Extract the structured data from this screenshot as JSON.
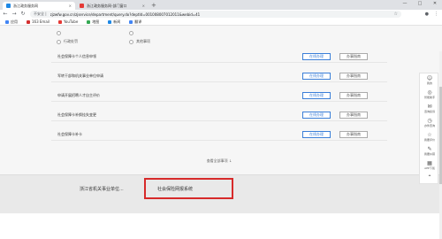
{
  "browser": {
    "tabs": [
      {
        "title": "浙江政务服务网",
        "close": "×"
      },
      {
        "title": "浙江政务服务网-部门窗口",
        "close": "×"
      }
    ],
    "new_tab": "+",
    "window_controls": [
      "—",
      "□",
      "✕"
    ],
    "nav": {
      "back": "←",
      "forward": "→",
      "reload": "↻"
    },
    "address": {
      "lock": "不安全 |",
      "url": "zjzwfw.gov.cn/zjservice/department/query.do?deptId=001008007012011&webid=41"
    },
    "bookmarks": [
      {
        "label": "应用",
        "color": "#4285f4"
      },
      {
        "label": "163 Email",
        "color": "#d32f2f"
      },
      {
        "label": "YouTube",
        "color": "#e53935"
      },
      {
        "label": "地图",
        "color": "#34a853"
      },
      {
        "label": "新闻",
        "color": "#1e88e5"
      },
      {
        "label": "翻译",
        "color": "#4285f4"
      }
    ]
  },
  "filters": {
    "row1": [
      "",
      ""
    ],
    "row2": [
      "行政处罚",
      "其他事项"
    ]
  },
  "services": [
    {
      "name": "社会保障卡个人信息申领",
      "online": "在线办理",
      "guide": "办事指南"
    },
    {
      "name": "军转干部和机关事业单位申请",
      "online": "在线办理",
      "guide": "办事指南"
    },
    {
      "name": "申请开展招聘人才自主评价",
      "online": "在线办理",
      "guide": "办事指南"
    },
    {
      "name": "社会保障卡补换挂失变更",
      "online": "在线办理",
      "guide": "办事指南"
    },
    {
      "name": "社会保障卡补卡",
      "online": "在线办理",
      "guide": "办事指南"
    }
  ],
  "more_label": "查看全部事项 ↓",
  "footer": {
    "item1": "浙江省机关事业单位...",
    "item2": "社会保险网报系统"
  },
  "side_panel": [
    {
      "icon": "person-icon",
      "glyph": "☺",
      "label": "我的"
    },
    {
      "icon": "assistant-icon",
      "glyph": "◎",
      "label": "智能助手"
    },
    {
      "icon": "chat-icon",
      "glyph": "✉",
      "label": "咨询投诉"
    },
    {
      "icon": "clock-icon",
      "glyph": "◷",
      "label": "办件查询"
    },
    {
      "icon": "evaluate-icon",
      "glyph": "☆",
      "label": "我要评价"
    },
    {
      "icon": "feedback-icon",
      "glyph": "✎",
      "label": "我要纠错"
    },
    {
      "icon": "app-icon",
      "glyph": "▦",
      "label": "APP下载"
    },
    {
      "icon": "top-icon",
      "glyph": "⌃",
      "label": ""
    }
  ]
}
